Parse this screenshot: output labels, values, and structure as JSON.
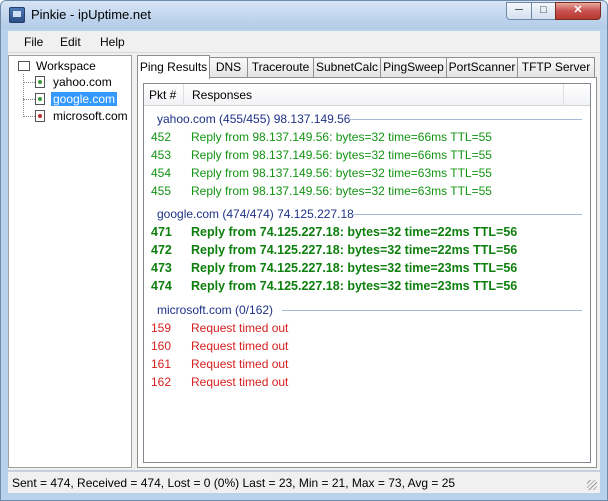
{
  "window": {
    "title": "Pinkie - ipUptime.net",
    "minimize": "─",
    "maximize": "□",
    "close": "✕"
  },
  "menu": [
    "File",
    "Edit",
    "Help"
  ],
  "tree": {
    "root": "Workspace",
    "items": [
      {
        "label": "yahoo.com",
        "selected": false,
        "status": "ok"
      },
      {
        "label": "google.com",
        "selected": true,
        "status": "ok"
      },
      {
        "label": "microsoft.com",
        "selected": false,
        "status": "down"
      }
    ]
  },
  "tabs": [
    "Ping Results",
    "DNS",
    "Traceroute",
    "SubnetCalc",
    "PingSweep",
    "PortScanner",
    "TFTP Server"
  ],
  "list": {
    "columns": [
      "Pkt #",
      "Responses"
    ],
    "groups": [
      {
        "title": "yahoo.com (455/455) 98.137.149.56",
        "style": "green",
        "rows": [
          {
            "pkt": "452",
            "resp": "Reply from 98.137.149.56: bytes=32 time=66ms TTL=55"
          },
          {
            "pkt": "453",
            "resp": "Reply from 98.137.149.56: bytes=32 time=66ms TTL=55"
          },
          {
            "pkt": "454",
            "resp": "Reply from 98.137.149.56: bytes=32 time=63ms TTL=55"
          },
          {
            "pkt": "455",
            "resp": "Reply from 98.137.149.56: bytes=32 time=63ms TTL=55"
          }
        ]
      },
      {
        "title": "google.com (474/474) 74.125.227.18",
        "style": "bold",
        "rows": [
          {
            "pkt": "471",
            "resp": "Reply from 74.125.227.18: bytes=32 time=22ms TTL=56"
          },
          {
            "pkt": "472",
            "resp": "Reply from 74.125.227.18: bytes=32 time=22ms TTL=56"
          },
          {
            "pkt": "473",
            "resp": "Reply from 74.125.227.18: bytes=32 time=23ms TTL=56"
          },
          {
            "pkt": "474",
            "resp": "Reply from 74.125.227.18: bytes=32 time=23ms TTL=56"
          }
        ]
      },
      {
        "title": "microsoft.com (0/162)",
        "style": "red",
        "rows": [
          {
            "pkt": "159",
            "resp": "Request timed out"
          },
          {
            "pkt": "160",
            "resp": "Request timed out"
          },
          {
            "pkt": "161",
            "resp": "Request timed out"
          },
          {
            "pkt": "162",
            "resp": "Request timed out"
          }
        ]
      }
    ]
  },
  "status": "Sent = 474, Received = 474, Lost = 0 (0%) Last = 23, Min = 21, Max = 73, Avg = 25",
  "colors": {
    "ok": "#129312",
    "ok_bold": "#0d7f0d",
    "timeout": "#d72020",
    "group_title": "#1e3287",
    "selection": "#3399ff"
  }
}
